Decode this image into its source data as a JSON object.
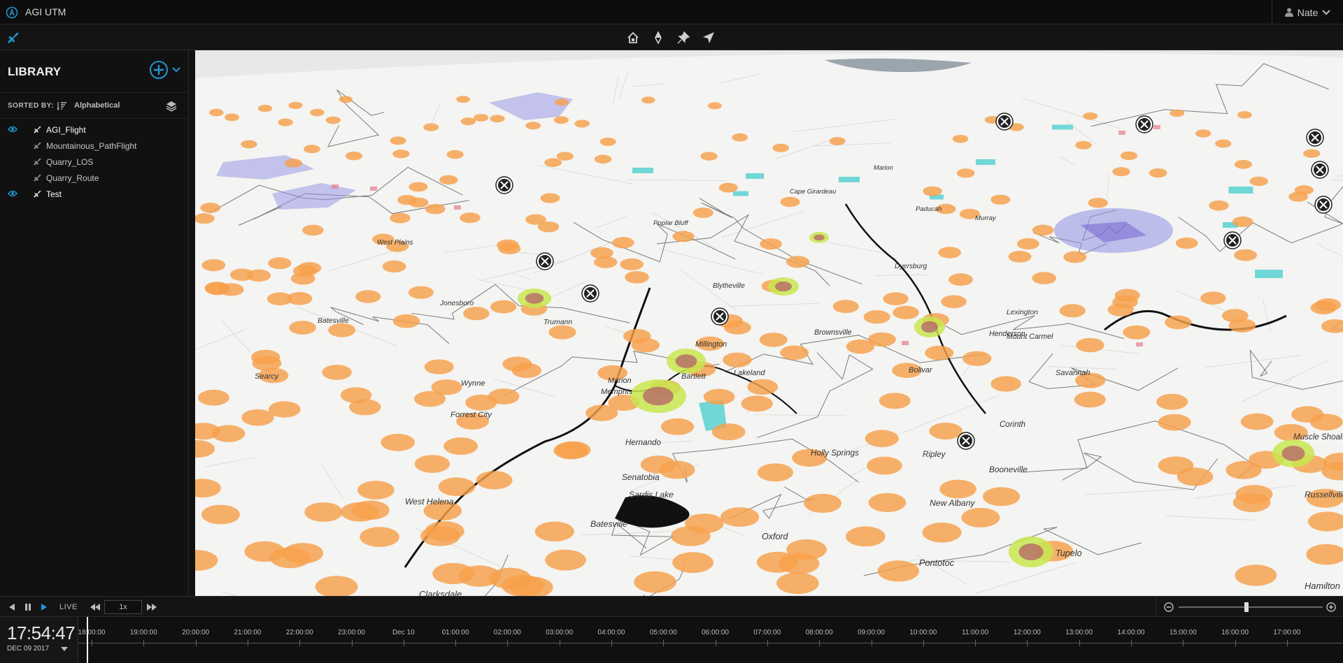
{
  "app": {
    "title": "AGI UTM",
    "user": "Nate",
    "accent": "#2196d3"
  },
  "toolbar": {
    "tools": [
      {
        "name": "home-view",
        "icon": "home-icon"
      },
      {
        "name": "compass",
        "icon": "compass-icon"
      },
      {
        "name": "pin",
        "icon": "pin-icon"
      },
      {
        "name": "navigate",
        "icon": "navigate-arrow-icon"
      }
    ]
  },
  "library": {
    "title": "LIBRARY",
    "sorted_by_label": "SORTED BY:",
    "sorted_by_value": "Alphabetical",
    "items": [
      {
        "label": "AGI_Flight",
        "visible": true
      },
      {
        "label": "Mountainous_PathFlight",
        "visible": false
      },
      {
        "label": "Quarry_LOS",
        "visible": false
      },
      {
        "label": "Quarry_Route",
        "visible": false
      },
      {
        "label": "Test",
        "visible": true
      }
    ]
  },
  "map": {
    "cities": [
      "West Plains",
      "Poplar Bluff",
      "Batesville",
      "Searcy",
      "Wynne",
      "Forrest City",
      "Marion",
      "Memphis",
      "Bartlett",
      "Lakeland",
      "Millington",
      "Hernando",
      "Senatobia",
      "Batesville",
      "Oxford",
      "Holly Springs",
      "Ripley",
      "New Albany",
      "Booneville",
      "Corinth",
      "Pontotoc",
      "Tupelo",
      "Russellville",
      "Hamilton",
      "West Helena",
      "Clarksdale",
      "Sardis Lake",
      "Paducah",
      "Murray",
      "Marion",
      "Cape Girardeau",
      "Henderson",
      "Lexington",
      "Savannah",
      "Brownsville",
      "Bolivar",
      "Dyersburg",
      "Blytheville",
      "Jonesboro",
      "Trumann",
      "Mount Carmel",
      "Muscle Shoals"
    ],
    "colors": {
      "land": "#f4f4f2",
      "zone_orange": "#f7a04a",
      "zone_green": "#c8e650",
      "zone_red": "#b4626a",
      "zone_cyan": "#4fd0d0",
      "zone_blue": "#8f8fe6",
      "water": "#111111"
    }
  },
  "playback": {
    "live_label": "LIVE",
    "speed": "1x"
  },
  "timeline": {
    "clock_time": "17:54:47",
    "clock_date": "DEC 09 2017",
    "ticks": [
      "18:00:00",
      "19:00:00",
      "20:00:00",
      "21:00:00",
      "22:00:00",
      "23:00:00",
      "Dec 10",
      "01:00:00",
      "02:00:00",
      "03:00:00",
      "04:00:00",
      "05:00:00",
      "06:00:00",
      "07:00:00",
      "08:00:00",
      "09:00:00",
      "10:00:00",
      "11:00:00",
      "12:00:00",
      "13:00:00",
      "14:00:00",
      "15:00:00",
      "16:00:00",
      "17:00:00"
    ]
  }
}
